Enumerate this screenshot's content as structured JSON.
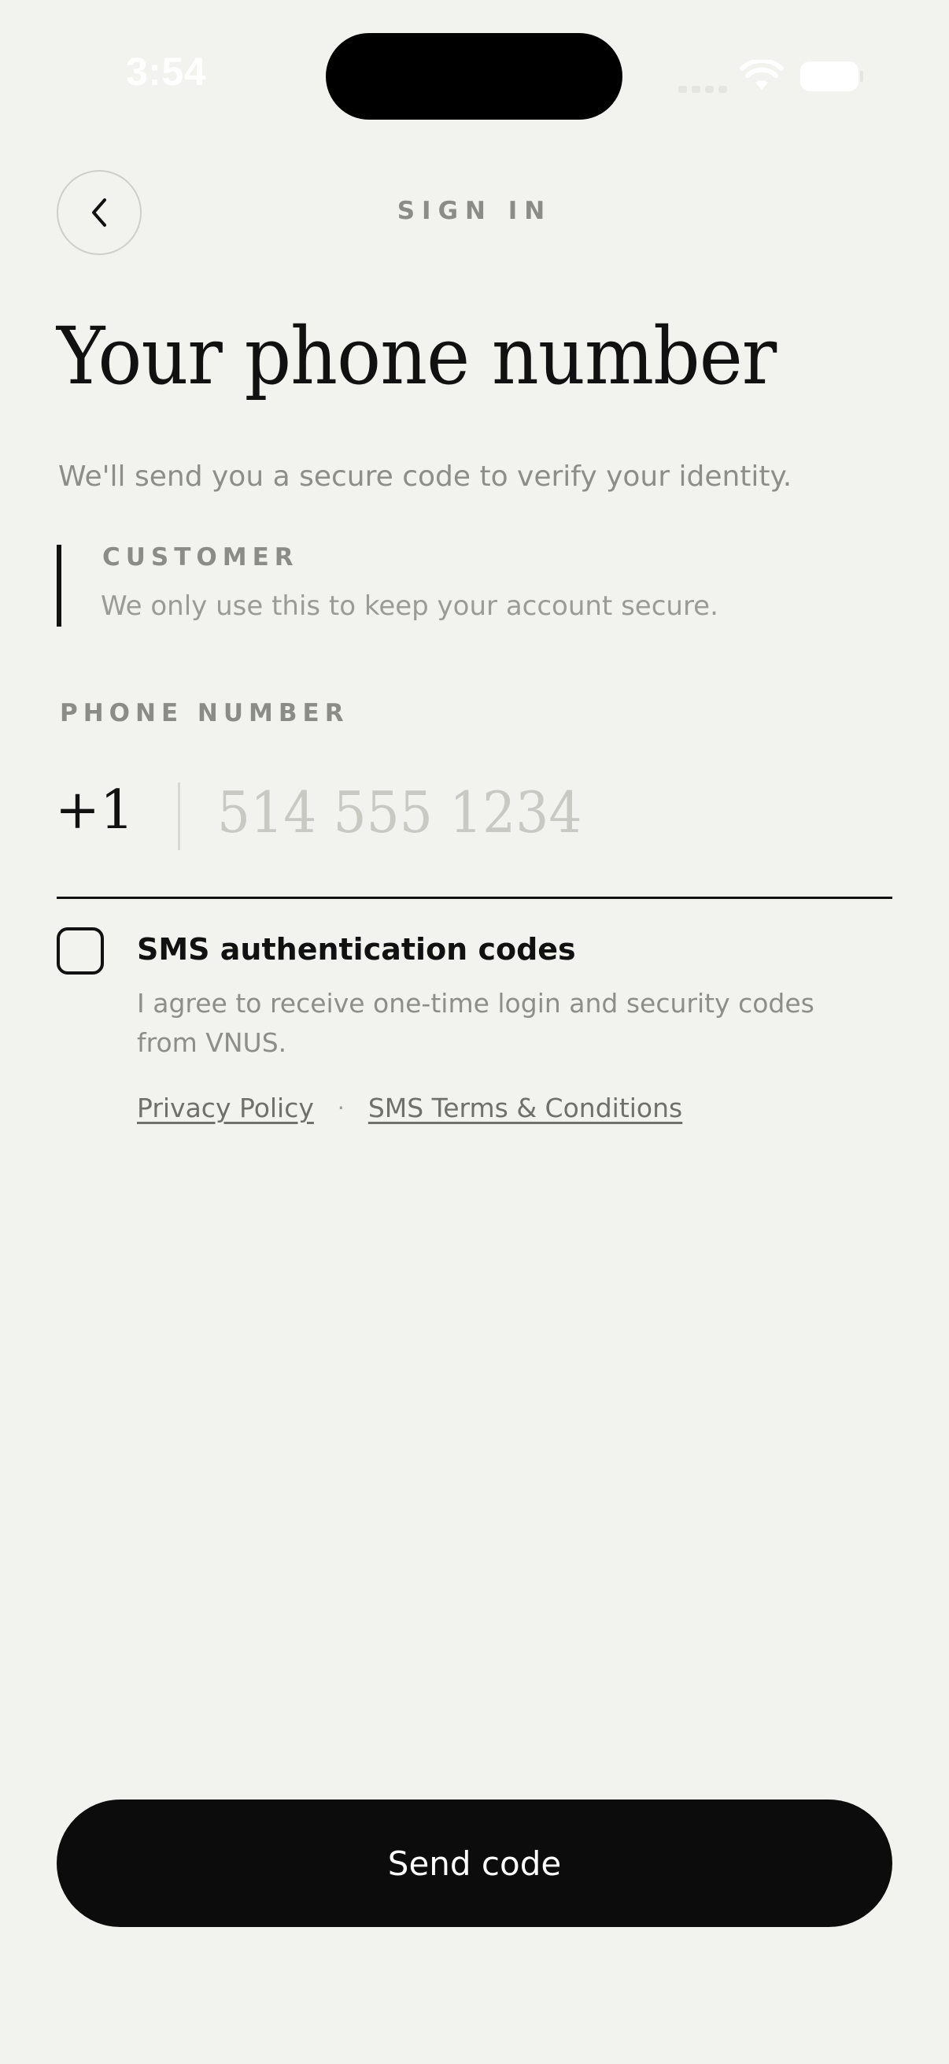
{
  "status_bar": {
    "time": "3:54"
  },
  "header": {
    "back_icon": "chevron-left-icon",
    "title": "SIGN IN"
  },
  "page": {
    "title": "Your phone number",
    "subtitle": "We'll send you a secure code to verify your identity."
  },
  "note": {
    "heading": "CUSTOMER",
    "text": "We only use this to keep your account secure."
  },
  "phone_field": {
    "label": "PHONE NUMBER",
    "country_code": "+1",
    "value": "",
    "placeholder": "514 555 1234"
  },
  "consent": {
    "checked": false,
    "title": "SMS authentication codes",
    "text": "I agree to receive one-time login and security codes from VNUS.",
    "links": {
      "privacy": "Privacy Policy",
      "separator": "·",
      "terms": "SMS Terms & Conditions"
    }
  },
  "actions": {
    "send_label": "Send code"
  },
  "colors": {
    "background": "#f2f2ee",
    "primary": "#0c0c0c",
    "muted_text": "#8b8b87",
    "placeholder": "#c9c9c4"
  }
}
